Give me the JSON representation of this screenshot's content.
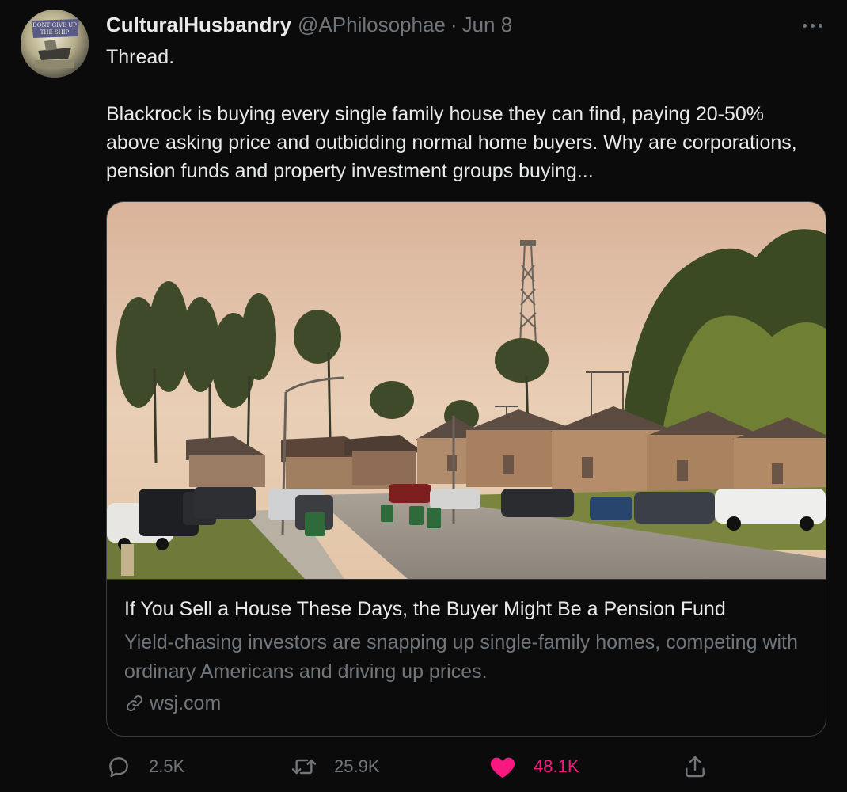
{
  "author": {
    "display_name": "CulturalHusbandry",
    "handle": "@APhilosophae",
    "separator": "·",
    "date": "Jun 8",
    "avatar_text": "DONT GIVE UP THE SHIP"
  },
  "tweet": {
    "text_line1": "Thread.",
    "text_body": "Blackrock is buying every single family house they can find, paying 20-50% above asking price and outbidding normal home buyers. Why are corporations, pension funds and property investment groups buying..."
  },
  "card": {
    "title": "If You Sell a House These Days, the Buyer Might Be a Pension Fund",
    "description": "Yield-chasing investors are snapping up single-family homes, competing with ordinary Americans and driving up prices.",
    "domain": "wsj.com",
    "image_icon": "suburban-street-photo"
  },
  "actions": {
    "reply_count": "2.5K",
    "retweet_count": "25.9K",
    "like_count": "48.1K"
  },
  "colors": {
    "background": "#0b0b0b",
    "text_primary": "#e7e9ea",
    "text_secondary": "#71767b",
    "like_pink": "#f91880",
    "card_border": "#3a3f44"
  },
  "icons": {
    "more": "more-icon",
    "reply": "reply-icon",
    "retweet": "retweet-icon",
    "like": "heart-icon",
    "share": "share-icon",
    "link": "link-icon"
  }
}
